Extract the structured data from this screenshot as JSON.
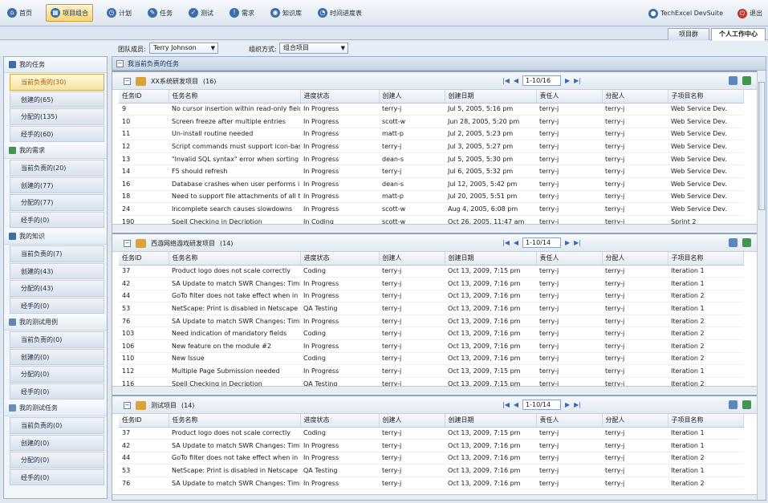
{
  "toolbar": {
    "items": [
      {
        "label": "首页",
        "icon": "home-icon"
      },
      {
        "label": "项目组合",
        "icon": "portfolio-icon"
      },
      {
        "label": "计划",
        "icon": "plan-icon"
      },
      {
        "label": "任务",
        "icon": "task-icon"
      },
      {
        "label": "测试",
        "icon": "test-icon"
      },
      {
        "label": "需求",
        "icon": "requirement-icon"
      },
      {
        "label": "知识库",
        "icon": "knowledge-icon"
      },
      {
        "label": "时间进度表",
        "icon": "timesheet-icon"
      }
    ],
    "brand": "TechExcel DevSuite",
    "logout": "退出"
  },
  "tabs": [
    "项目群",
    "个人工作中心"
  ],
  "filters": {
    "member_label": "团队成员:",
    "member_value": "Terry Johnson",
    "org_label": "组织方式:",
    "org_value": "组合项目"
  },
  "sidebar": [
    {
      "title": "我的任务",
      "items": [
        "当前负责的(30)",
        "创建的(65)",
        "分配的(135)",
        "经手的(60)"
      ]
    },
    {
      "title": "我的需求",
      "items": [
        "当前负责的(20)",
        "创建的(77)",
        "分配的(77)",
        "经手的(0)"
      ]
    },
    {
      "title": "我的知识",
      "items": [
        "当前负责的(7)",
        "创建的(43)",
        "分配的(43)",
        "经手的(0)"
      ]
    },
    {
      "title": "我的测试用例",
      "items": [
        "当前负责的(0)",
        "创建的(0)",
        "分配的(0)",
        "经手的(0)"
      ]
    },
    {
      "title": "我的测试任务",
      "items": [
        "当前负责的(0)",
        "创建的(0)",
        "分配的(0)",
        "经手的(0)"
      ]
    }
  ],
  "main_title": "我当前负责的任务",
  "columns": [
    "任务ID",
    "任务名称",
    "进度状态",
    "创建人",
    "创建日期",
    "责任人",
    "分配人",
    "子项目名称"
  ],
  "projects": [
    {
      "name": "XX系统研发项目",
      "count": "(16)",
      "pager": "1-10/16",
      "rows": [
        [
          "9",
          "No cursor insertion within read-only fields",
          "In Progress",
          "terry-j",
          "Jul 5, 2005, 5:16 pm",
          "terry-j",
          "terry-j",
          "Web Service Dev."
        ],
        [
          "10",
          "Screen freeze after multiple entries",
          "In Progress",
          "scott-w",
          "Jun 28, 2005, 5:20 pm",
          "terry-j",
          "terry-j",
          "Web Service Dev."
        ],
        [
          "11",
          "Un-install routine needed",
          "In Progress",
          "matt-p",
          "Jul 2, 2005, 5:23 pm",
          "terry-j",
          "terry-j",
          "Web Service Dev."
        ],
        [
          "12",
          "Script commands must support icon-based a",
          "In Progress",
          "terry-j",
          "Jul 3, 2005, 5:27 pm",
          "terry-j",
          "terry-j",
          "Web Service Dev."
        ],
        [
          "13",
          "\"Invalid SQL syntax\" error when sorting",
          "In Progress",
          "dean-s",
          "Jul 5, 2005, 5:30 pm",
          "terry-j",
          "terry-j",
          "Web Service Dev."
        ],
        [
          "14",
          "F5 should refresh",
          "In Progress",
          "terry-j",
          "Jul 6, 2005, 5:32 pm",
          "terry-j",
          "terry-j",
          "Web Service Dev."
        ],
        [
          "16",
          "Database crashes when user performs illeg",
          "In Progress",
          "dean-s",
          "Jul 12, 2005, 5:42 pm",
          "terry-j",
          "terry-j",
          "Web Service Dev."
        ],
        [
          "18",
          "Need to support file attachments of all types",
          "In Progress",
          "matt-p",
          "Jul 20, 2005, 5:51 pm",
          "terry-j",
          "terry-j",
          "Web Service Dev."
        ],
        [
          "24",
          "Incomplete search causes slowdowns",
          "In Progress",
          "scott-w",
          "Aug 4, 2005, 6:08 pm",
          "terry-j",
          "terry-j",
          "Web Service Dev."
        ],
        [
          "190",
          "Spell Checking in Decription",
          "In Coding",
          "scott-w",
          "Oct 26, 2005, 11:47 am",
          "terry-j",
          "terry-j",
          "Sprint 2"
        ]
      ]
    },
    {
      "name": "西游网络游戏研发项目",
      "count": "(14)",
      "pager": "1-10/14",
      "rows": [
        [
          "37",
          "Product logo does not scale correctly",
          "Coding",
          "terry-j",
          "Oct 13, 2009, 7:15 pm",
          "terry-j",
          "terry-j",
          "Iteration 1"
        ],
        [
          "42",
          "SA Update to match SWR Changes: Timing",
          "In Progress",
          "terry-j",
          "Oct 13, 2009, 7:16 pm",
          "terry-j",
          "terry-j",
          "Iteration 1"
        ],
        [
          "44",
          "GoTo filter does not take effect when in repo",
          "In Progress",
          "terry-j",
          "Oct 13, 2009, 7:16 pm",
          "terry-j",
          "terry-j",
          "Iteration 2"
        ],
        [
          "53",
          "NetScape: Print is disabled in Netscape",
          "QA Testing",
          "terry-j",
          "Oct 13, 2009, 7:16 pm",
          "terry-j",
          "terry-j",
          "Iteration 1"
        ],
        [
          "76",
          "SA Update to match SWR Changes: Timing",
          "In Progress",
          "terry-j",
          "Oct 13, 2009, 7:16 pm",
          "terry-j",
          "terry-j",
          "Iteration 2"
        ],
        [
          "103",
          "Need indication of mandatory fields",
          "Coding",
          "terry-j",
          "Oct 13, 2009, 7:16 pm",
          "terry-j",
          "terry-j",
          "Iteration 2"
        ],
        [
          "106",
          "New feature on the module #2",
          "In Progress",
          "terry-j",
          "Oct 13, 2009, 7:16 pm",
          "terry-j",
          "terry-j",
          "Iteration 2"
        ],
        [
          "110",
          "New Issue",
          "Coding",
          "terry-j",
          "Oct 13, 2009, 7:16 pm",
          "terry-j",
          "terry-j",
          "Iteration 2"
        ],
        [
          "112",
          "Multiple Page Submission needed",
          "In Progress",
          "terry-j",
          "Oct 13, 2009, 7:15 pm",
          "terry-j",
          "terry-j",
          "Iteration 1"
        ],
        [
          "116",
          "Spell Checking in Decription",
          "QA Testing",
          "terry-j",
          "Oct 13, 2009, 7:15 pm",
          "terry-j",
          "terry-j",
          "Iteration 2"
        ]
      ]
    },
    {
      "name": "测试项目",
      "count": "(14)",
      "pager": "1-10/14",
      "rows": [
        [
          "37",
          "Product logo does not scale correctly",
          "Coding",
          "terry-j",
          "Oct 13, 2009, 7:15 pm",
          "terry-j",
          "terry-j",
          "Iteration 1"
        ],
        [
          "42",
          "SA Update to match SWR Changes: Timing",
          "In Progress",
          "terry-j",
          "Oct 13, 2009, 7:16 pm",
          "terry-j",
          "terry-j",
          "Iteration 1"
        ],
        [
          "44",
          "GoTo filter does not take effect when in repo",
          "In Progress",
          "terry-j",
          "Oct 13, 2009, 7:16 pm",
          "terry-j",
          "terry-j",
          "Iteration 2"
        ],
        [
          "53",
          "NetScape: Print is disabled in Netscape",
          "QA Testing",
          "terry-j",
          "Oct 13, 2009, 7:16 pm",
          "terry-j",
          "terry-j",
          "Iteration 1"
        ],
        [
          "76",
          "SA Update to match SWR Changes: Timing",
          "In Progress",
          "terry-j",
          "Oct 13, 2009, 7:16 pm",
          "terry-j",
          "terry-j",
          "Iteration 2"
        ]
      ]
    }
  ]
}
